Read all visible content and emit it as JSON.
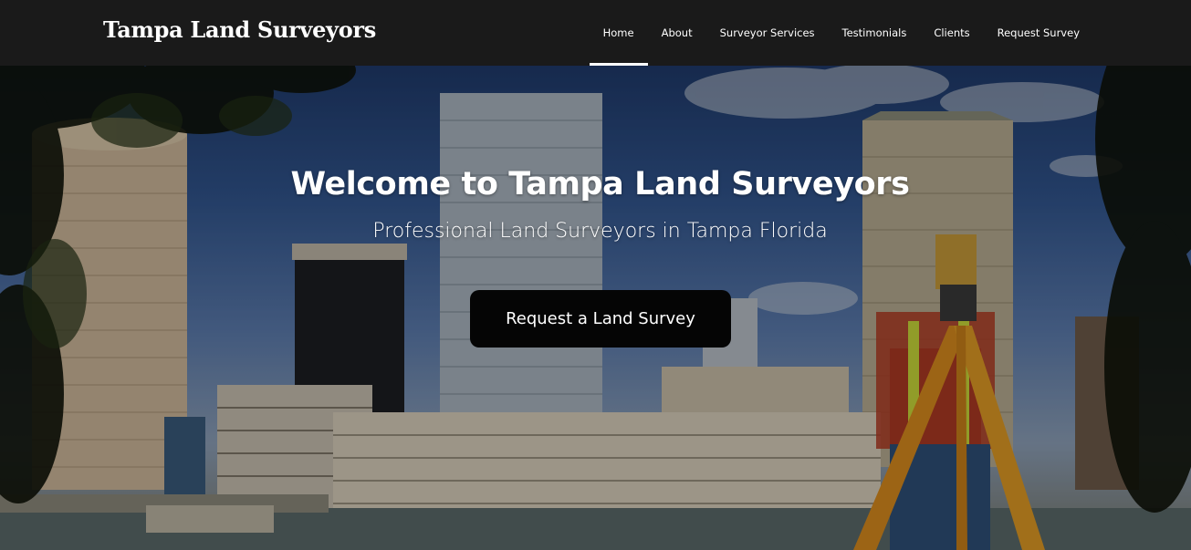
{
  "site": {
    "logo_text": "Tampa Land Surveyors"
  },
  "nav": {
    "items": [
      {
        "label": "Home",
        "active": true
      },
      {
        "label": "About",
        "active": false
      },
      {
        "label": "Surveyor Services",
        "active": false
      },
      {
        "label": "Testimonials",
        "active": false
      },
      {
        "label": "Clients",
        "active": false
      },
      {
        "label": "Request Survey",
        "active": false
      }
    ]
  },
  "hero": {
    "title": "Welcome to Tampa Land Surveyors",
    "subtitle": "Professional Land Surveyors in Tampa Florida",
    "cta_label": "Request a Land Survey",
    "background": "city-skyline-surveyor-photo"
  },
  "colors": {
    "header_bg": "#1a1a1a",
    "nav_text": "#ffffff",
    "cta_bg": "#050505",
    "active_indicator": "#ffffff"
  }
}
